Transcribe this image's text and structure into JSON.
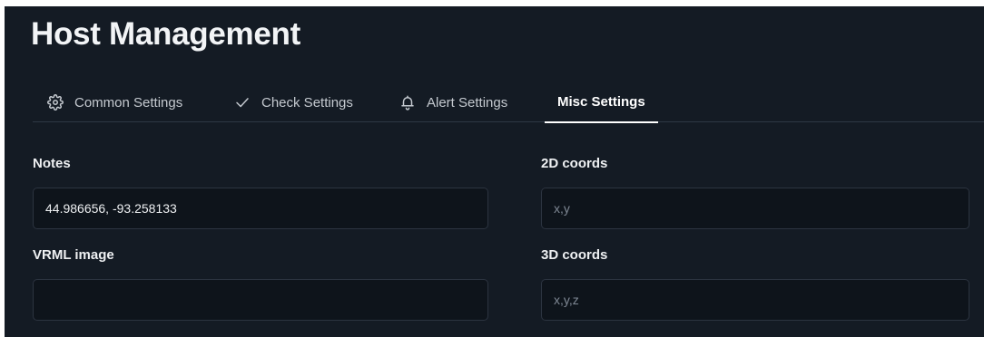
{
  "page": {
    "title": "Host Management"
  },
  "tabs": [
    {
      "label": "Common Settings",
      "icon": "gear-icon",
      "active": false
    },
    {
      "label": "Check Settings",
      "icon": "check-icon",
      "active": false
    },
    {
      "label": "Alert Settings",
      "icon": "bell-icon",
      "active": false
    },
    {
      "label": "Misc Settings",
      "icon": "",
      "active": true
    }
  ],
  "form": {
    "notes": {
      "label": "Notes",
      "value": "44.986656, -93.258133",
      "placeholder": ""
    },
    "vrml_image": {
      "label": "VRML image",
      "value": "",
      "placeholder": ""
    },
    "coords_2d": {
      "label": "2D coords",
      "value": "",
      "placeholder": "x,y"
    },
    "coords_3d": {
      "label": "3D coords",
      "value": "",
      "placeholder": "x,y,z"
    }
  },
  "colors": {
    "background": "#141b24",
    "input_background": "#0e141b",
    "input_border": "#2c3440",
    "text": "#e6e8ea",
    "muted_text": "#c4c9cf",
    "placeholder": "#7f8894",
    "active_tab_indicator": "#ffffff"
  }
}
